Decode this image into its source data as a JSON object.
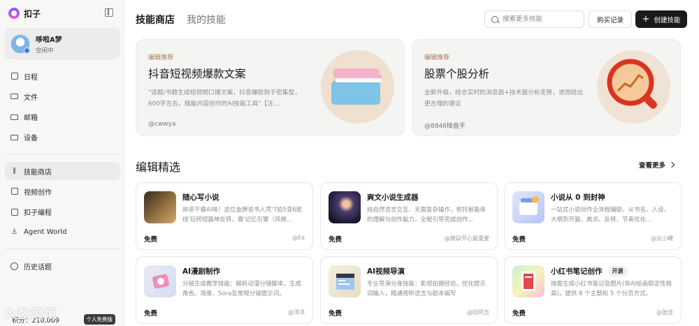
{
  "brand": {
    "name": "扣子"
  },
  "user": {
    "name": "哆啦A梦",
    "status": "空闲中"
  },
  "nav_top": [
    {
      "label": "日程",
      "icon": "calendar-icon"
    },
    {
      "label": "文件",
      "icon": "folder-icon"
    },
    {
      "label": "邮箱",
      "icon": "mail-icon"
    },
    {
      "label": "设备",
      "icon": "monitor-icon"
    }
  ],
  "nav_mid": [
    {
      "label": "技能商店",
      "icon": "library-icon",
      "active": true
    },
    {
      "label": "视频创作",
      "icon": "video-icon"
    },
    {
      "label": "扣子编程",
      "icon": "code-icon"
    },
    {
      "label": "Agent World",
      "icon": "agent-icon"
    }
  ],
  "nav_bottom": [
    {
      "label": "历史话题",
      "icon": "clock-icon"
    }
  ],
  "points": {
    "text": "积分：210,009",
    "plan": "个人免费版"
  },
  "watermark": "大数跨境",
  "header": {
    "tabs": [
      "技能商店",
      "我的技能"
    ],
    "search_placeholder": "搜索更多技能",
    "records_label": "购买记录",
    "create_label": "创建技能"
  },
  "featured": [
    {
      "tag": "编辑推荐",
      "title": "抖音短视频爆款文案",
      "desc": "\"话题/书籍生成短视频口播文案，抖音爆款钩子密集型，600字左右，赋能内容创作的AI技能工具\"【注...",
      "author": "@cwwya"
    },
    {
      "tag": "编辑推荐",
      "title": "股票个股分析",
      "desc": "全新升级，结合实时的消息面+技术面分析走势，进而给出更合理的建议",
      "author": "@8848操盘手"
    }
  ],
  "section": {
    "title": "编辑精选",
    "more_label": "查看更多"
  },
  "cards": [
    {
      "name": "随心写小说",
      "desc": "辞退干瘪AI味！这位金牌说书人凭'7拍5变6航线'玩转短篇神反转，靠'记忆引擎（风格...",
      "price": "免费",
      "author": "@Ee",
      "badge": ""
    },
    {
      "name": "爽文小说生成器",
      "desc": "纯自然语言交互、无需复杂操作，依托智能体的理解与创作能力，全程引导完成创作...",
      "price": "免费",
      "author": "@微😺开心最重要",
      "badge": ""
    },
    {
      "name": "小说从 0 到封神",
      "desc": "一站式小说创作全流程辅助，从书名、人设、大纲到开篇、爽点、反转、节奏优化...",
      "price": "免费",
      "author": "@云小鲤",
      "badge": ""
    },
    {
      "name": "AI漫剧制作",
      "desc": "分镜生成教学技能：解析动漫分镜脚本，生成角色、场景、Sora及常规分镜提示词。",
      "price": "免费",
      "author": "@洋洋",
      "badge": ""
    },
    {
      "name": "AI视频导演",
      "desc": "专业导演分身技能：影视拍摄经验，优化提示词输入，精通视听语言与剧本编写",
      "price": "免费",
      "author": "@陆阿吉",
      "badge": ""
    },
    {
      "name": "小红书笔记创作",
      "desc": "按需生成小红书笔记及图片(非AI绘画稳定性极高)，提供 8 个主题和 5 个分页方式。",
      "price": "免费",
      "author": "@张佳",
      "badge": "开源"
    }
  ]
}
